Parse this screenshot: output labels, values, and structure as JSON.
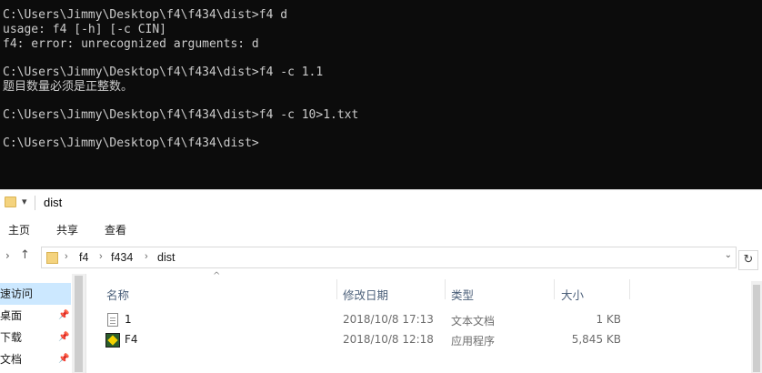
{
  "console": {
    "lines": [
      "C:\\Users\\Jimmy\\Desktop\\f4\\f434\\dist>f4 d",
      "usage: f4 [-h] [-c CIN]",
      "f4: error: unrecognized arguments: d",
      "",
      "C:\\Users\\Jimmy\\Desktop\\f4\\f434\\dist>f4 -c 1.1",
      "题目数量必须是正整数。",
      "",
      "C:\\Users\\Jimmy\\Desktop\\f4\\f434\\dist>f4 -c 10>1.txt",
      "",
      "C:\\Users\\Jimmy\\Desktop\\f4\\f434\\dist>"
    ]
  },
  "explorer": {
    "title": "dist",
    "qat_glyph": "▾",
    "ribbon_tabs": [
      "主页",
      "共享",
      "查看"
    ],
    "address": {
      "segments": [
        "f4",
        "f434",
        "dist"
      ]
    },
    "nav_items": [
      {
        "label": "速访问",
        "selected": true,
        "pinned": false
      },
      {
        "label": "桌面",
        "selected": false,
        "pinned": true
      },
      {
        "label": "下载",
        "selected": false,
        "pinned": true
      },
      {
        "label": "文档",
        "selected": false,
        "pinned": true
      }
    ],
    "columns": [
      "名称",
      "修改日期",
      "类型",
      "大小"
    ],
    "files": [
      {
        "name": "1",
        "modified": "2018/10/8 17:13",
        "type": "文本文档",
        "size": "1 KB",
        "icon": "text-document-icon"
      },
      {
        "name": "F4",
        "modified": "2018/10/8 12:18",
        "type": "应用程序",
        "size": "5,845 KB",
        "icon": "application-icon"
      }
    ]
  },
  "colors": {
    "console_bg": "#0c0c0c",
    "console_fg": "#cccccc",
    "selection": "#cce8ff",
    "folder": "#f4d37e",
    "column_header": "#4c607a"
  }
}
